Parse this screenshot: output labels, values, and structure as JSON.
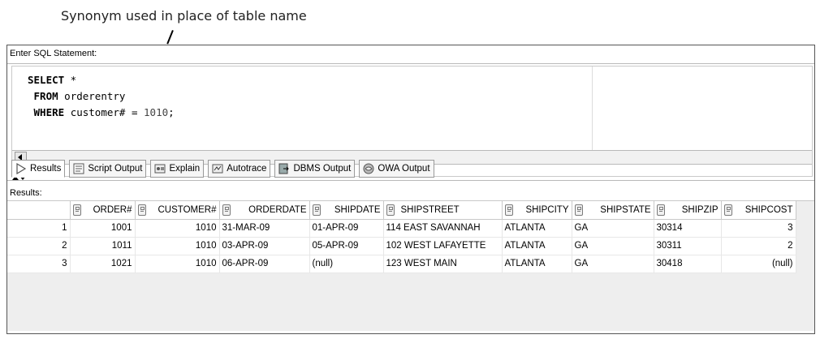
{
  "annotation": {
    "text": "Synonym used in place of table name"
  },
  "sql": {
    "label": "Enter SQL Statement:",
    "lines": [
      {
        "kw": "SELECT",
        "rest": " *"
      },
      {
        "kw": "FROM",
        "rest": " orderentry"
      },
      {
        "kw": "WHERE",
        "rest": " customer# = ",
        "num": "1010",
        "tail": ";"
      }
    ]
  },
  "tabs": [
    {
      "label": "Results",
      "icon": "results-play-icon",
      "active": true
    },
    {
      "label": "Script Output",
      "icon": "script-output-icon"
    },
    {
      "label": "Explain",
      "icon": "explain-icon"
    },
    {
      "label": "Autotrace",
      "icon": "autotrace-icon"
    },
    {
      "label": "DBMS Output",
      "icon": "dbms-output-icon"
    },
    {
      "label": "OWA Output",
      "icon": "owa-output-icon"
    }
  ],
  "results": {
    "label": "Results:",
    "columns": [
      "ORDER#",
      "CUSTOMER#",
      "ORDERDATE",
      "SHIPDATE",
      "SHIPSTREET",
      "SHIPCITY",
      "SHIPSTATE",
      "SHIPZIP",
      "SHIPCOST"
    ],
    "rows": [
      [
        "1",
        "1001",
        "1010",
        "31-MAR-09",
        "01-APR-09",
        "114 EAST SAVANNAH",
        "ATLANTA",
        "GA",
        "30314",
        "3"
      ],
      [
        "2",
        "1011",
        "1010",
        "03-APR-09",
        "05-APR-09",
        "102 WEST LAFAYETTE",
        "ATLANTA",
        "GA",
        "30311",
        "2"
      ],
      [
        "3",
        "1021",
        "1010",
        "06-APR-09",
        "(null)",
        "123 WEST MAIN",
        "ATLANTA",
        "GA",
        "30418",
        "(null)"
      ]
    ]
  }
}
